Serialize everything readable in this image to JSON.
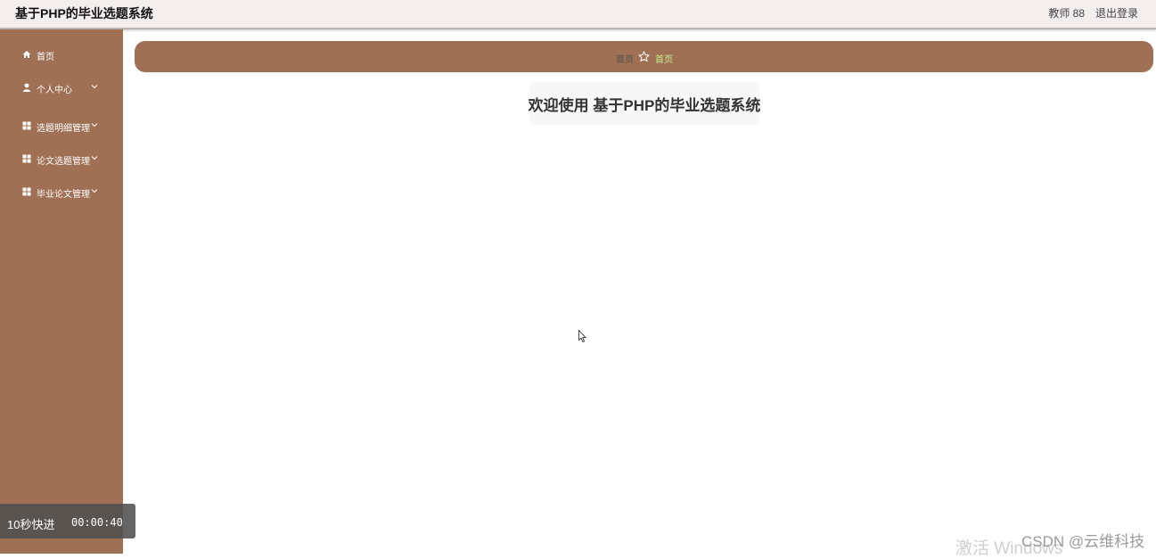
{
  "header": {
    "title": "基于PHP的毕业选题系统",
    "user": "教师 88",
    "logout_label": "退出登录"
  },
  "sidebar": {
    "items": [
      {
        "label": "首页",
        "icon": "home-icon",
        "has_chevron": false
      },
      {
        "label": "个人中心",
        "icon": "user-icon",
        "has_chevron": true
      },
      {
        "label": "选题明细管理",
        "icon": "grid-icon",
        "has_chevron": true
      },
      {
        "label": "论文选题管理",
        "icon": "grid-icon",
        "has_chevron": true
      },
      {
        "label": "毕业论文管理",
        "icon": "grid-icon",
        "has_chevron": true
      }
    ]
  },
  "breadcrumb": {
    "home": "首页",
    "current": "首页"
  },
  "main": {
    "welcome": "欢迎使用 基于PHP的毕业选题系统"
  },
  "overlay": {
    "fast_forward_label": "10秒快进",
    "time": "00:00:40",
    "activate_windows": "激活 Windows",
    "watermark": "CSDN @云维科技"
  },
  "colors": {
    "sidebar": "#a07055",
    "topbar": "#f4efee",
    "breadcrumb_current": "#c8ef8a"
  }
}
